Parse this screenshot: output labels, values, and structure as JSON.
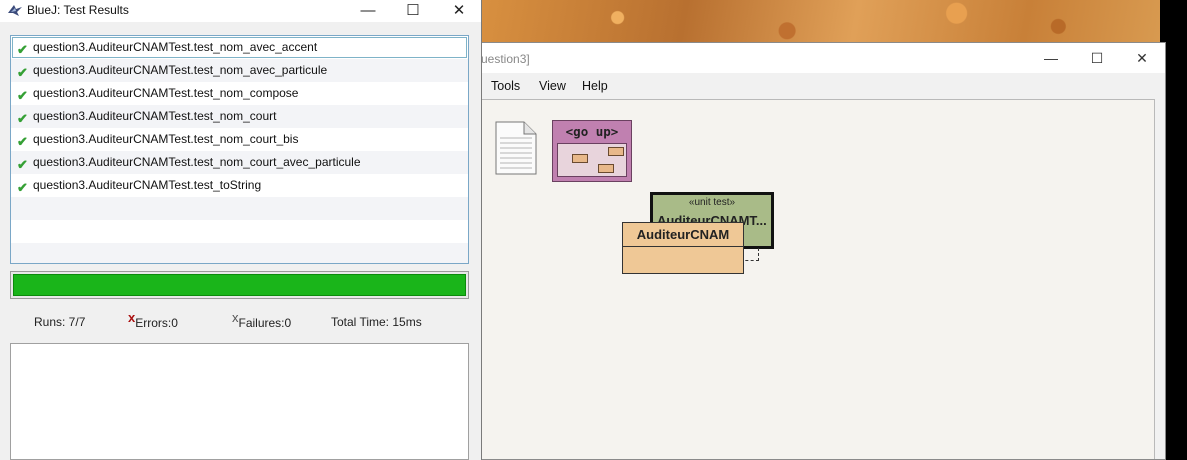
{
  "main_window": {
    "title_partial": "uestion3]",
    "menu": [
      "Tools",
      "View",
      "Help"
    ],
    "go_up_label": "<go up>",
    "test_class": {
      "stereotype": "«unit test»",
      "name": "AuditeurCNAMT..."
    },
    "class_name": "AuditeurCNAM"
  },
  "test_results": {
    "title": "BlueJ:  Test Results",
    "tests": [
      "question3.AuditeurCNAMTest.test_nom_avec_accent",
      "question3.AuditeurCNAMTest.test_nom_avec_particule",
      "question3.AuditeurCNAMTest.test_nom_compose",
      "question3.AuditeurCNAMTest.test_nom_court",
      "question3.AuditeurCNAMTest.test_nom_court_bis",
      "question3.AuditeurCNAMTest.test_nom_court_avec_particule",
      "question3.AuditeurCNAMTest.test_toString"
    ],
    "progress_fraction": 1.0,
    "progress_color": "#1ab51a",
    "runs": "Runs:  7/7",
    "errors": "Errors:0",
    "failures": "Failures:0",
    "total_time": "Total Time:  15ms"
  },
  "colors": {
    "package_pink": "#c080b0",
    "test_green": "#a9bb88",
    "class_orange": "#efc896"
  }
}
